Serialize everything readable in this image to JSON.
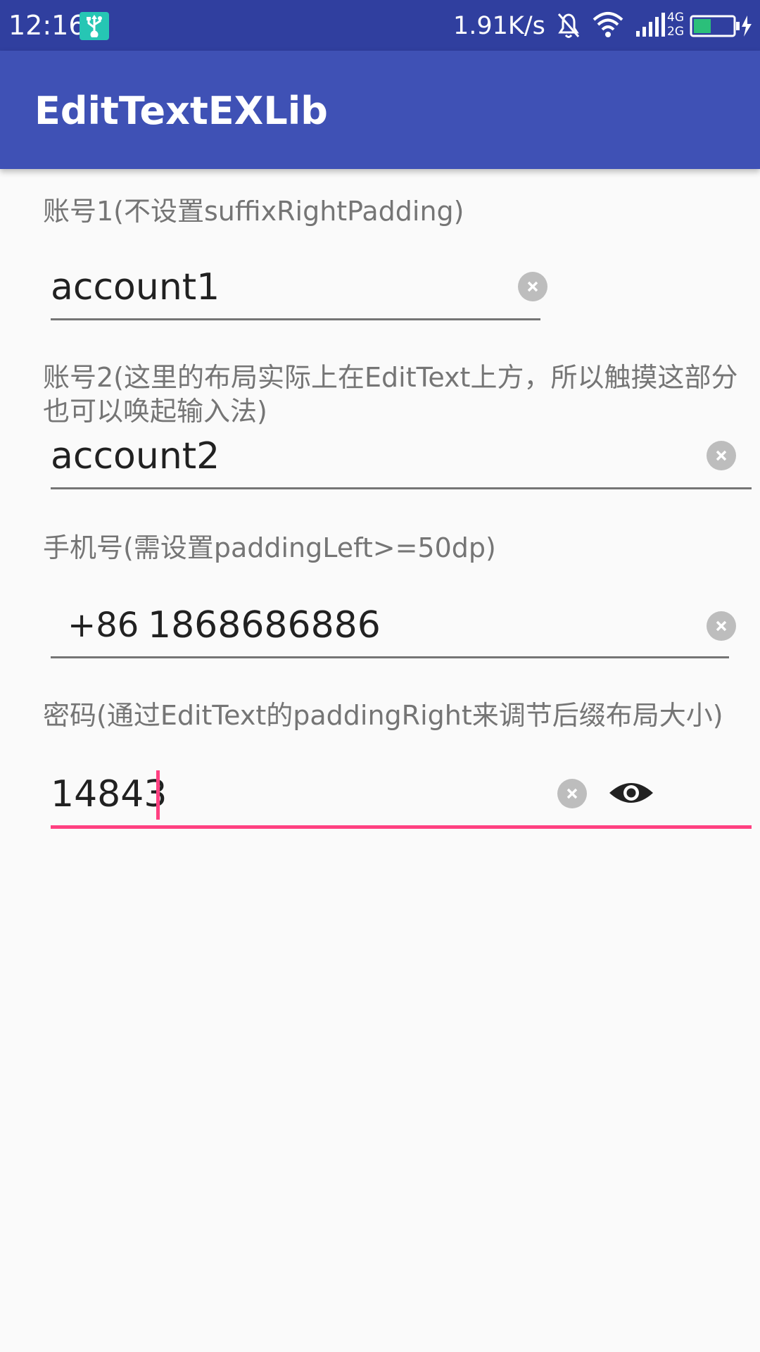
{
  "status_bar": {
    "time": "12:16",
    "net_speed": "1.91K/s",
    "usb_icon": "usb-debug-icon",
    "icons": [
      "bell-off-icon",
      "wifi-icon",
      "cell-signal-icon",
      "battery-charging-icon"
    ],
    "network_4g": "4G",
    "network_2g": "2G"
  },
  "app_bar": {
    "title": "EditTextEXLib"
  },
  "fields": [
    {
      "label": "账号1(不设置suffixRightPadding)",
      "value": "account1"
    },
    {
      "label": "账号2(这里的布局实际上在EditText上方，所以触摸这部分也可以唤起输入法)",
      "value": "account2"
    },
    {
      "label": "手机号(需设置paddingLeft>=50dp)",
      "prefix": "+86",
      "value": "1868686886"
    },
    {
      "label": "密码(通过EditText的paddingRight来调节后缀布局大小)",
      "value": "14843"
    }
  ],
  "colors": {
    "status_bar": "#303F9F",
    "app_bar": "#3F51B5",
    "accent": "#FF4081",
    "background": "#FAFAFA"
  }
}
